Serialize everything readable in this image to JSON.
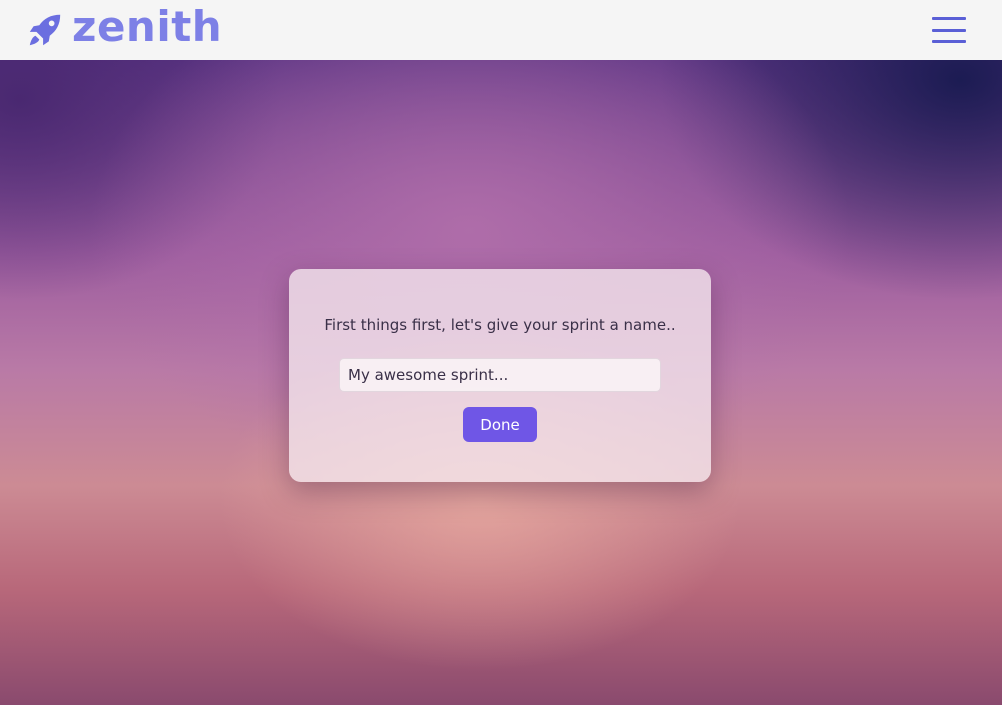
{
  "brand": {
    "name": "zenith",
    "icon": "rocket-icon",
    "color": "#6b6ee0"
  },
  "nav": {
    "menu_icon": "hamburger-menu-icon",
    "menu_color": "#5a5fd6"
  },
  "sprint_modal": {
    "prompt": "First things first, let's give your sprint a name..",
    "input_placeholder": "My awesome sprint...",
    "input_value": "",
    "done_label": "Done",
    "done_color": "#6f56e6"
  }
}
